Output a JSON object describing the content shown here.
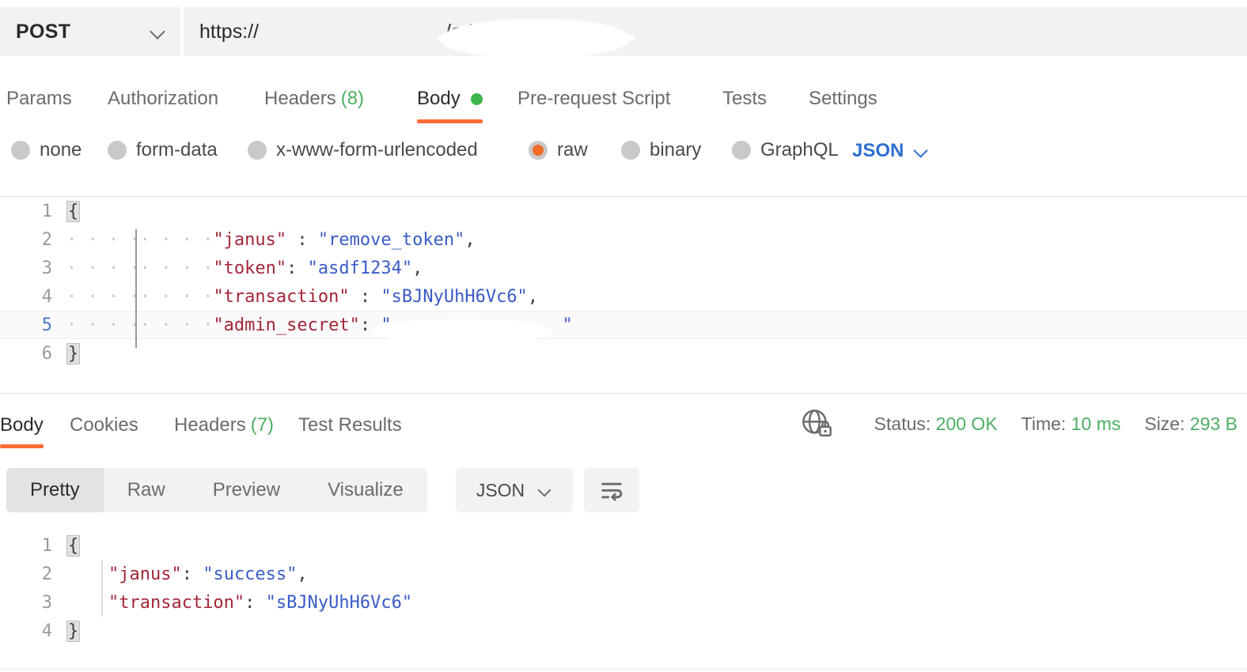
{
  "request": {
    "method": "POST",
    "method_icon": "chevron-down-icon",
    "url_prefix": "https://",
    "url_suffix": "/admin",
    "url_full": "https:// /admin",
    "url_redacted": true,
    "tabs": [
      {
        "label": "Params",
        "active": false,
        "count": "",
        "dot": false
      },
      {
        "label": "Authorization",
        "active": false,
        "count": "",
        "dot": false
      },
      {
        "label": "Headers",
        "active": false,
        "count": "(8)",
        "dot": false
      },
      {
        "label": "Body",
        "active": true,
        "count": "",
        "dot": true
      },
      {
        "label": "Pre-request Script",
        "active": false,
        "count": "",
        "dot": false
      },
      {
        "label": "Tests",
        "active": false,
        "count": "",
        "dot": false
      },
      {
        "label": "Settings",
        "active": false,
        "count": "",
        "dot": false
      }
    ],
    "body_types": [
      {
        "label": "none",
        "selected": false
      },
      {
        "label": "form-data",
        "selected": false
      },
      {
        "label": "x-www-form-urlencoded",
        "selected": false
      },
      {
        "label": "raw",
        "selected": true
      },
      {
        "label": "binary",
        "selected": false
      },
      {
        "label": "GraphQL",
        "selected": false
      }
    ],
    "format": "JSON",
    "format_icon": "chevron-down-icon",
    "body_lines": [
      {
        "n": "1",
        "active": false
      },
      {
        "n": "2",
        "active": false
      },
      {
        "n": "3",
        "active": false
      },
      {
        "n": "4",
        "active": false
      },
      {
        "n": "5",
        "active": true
      },
      {
        "n": "6",
        "active": false
      }
    ],
    "body": {
      "l1_brace": "{",
      "l2_key": "\"janus\"",
      "l2_colon": " : ",
      "l2_val": "\"remove_token\"",
      "l2_comma": ",",
      "l3_key": "\"token\"",
      "l3_colon": ": ",
      "l3_val": "\"asdf1234\"",
      "l3_comma": ",",
      "l4_key": "\"transaction\"",
      "l4_colon": " : ",
      "l4_val": "\"sBJNyUhH6Vc6\"",
      "l4_comma": ",",
      "l5_key": "\"admin_secret\"",
      "l5_colon": ": ",
      "l5_val_open": "\"",
      "l5_val_close": "\"",
      "l6_brace": "}",
      "indent": "· · · ·· · · ·"
    }
  },
  "response": {
    "tabs": [
      {
        "label": "Body",
        "active": true,
        "count": ""
      },
      {
        "label": "Cookies",
        "active": false,
        "count": ""
      },
      {
        "label": "Headers",
        "active": false,
        "count": "(7)"
      },
      {
        "label": "Test Results",
        "active": false,
        "count": ""
      }
    ],
    "security_icon": "globe-lock-icon",
    "meta": {
      "status_label": "Status:",
      "status_value": "200 OK",
      "time_label": "Time:",
      "time_value": "10 ms",
      "size_label": "Size:",
      "size_value": "293 B"
    },
    "view_modes": [
      {
        "label": "Pretty",
        "active": true
      },
      {
        "label": "Raw",
        "active": false
      },
      {
        "label": "Preview",
        "active": false
      },
      {
        "label": "Visualize",
        "active": false
      }
    ],
    "format": "JSON",
    "format_icon": "chevron-down-icon",
    "wrap_icon": "word-wrap-icon",
    "body_lines": [
      {
        "n": "1"
      },
      {
        "n": "2"
      },
      {
        "n": "3"
      },
      {
        "n": "4"
      }
    ],
    "body": {
      "l1_brace": "{",
      "l2_key": "\"janus\"",
      "l2_colon": ": ",
      "l2_val": "\"success\"",
      "l2_comma": ",",
      "l3_key": "\"transaction\"",
      "l3_colon": ": ",
      "l3_val": "\"sBJNyUhH6Vc6\"",
      "l3_comma": "",
      "l4_brace": "}",
      "indent": "    "
    }
  },
  "colors": {
    "accent_orange": "#ff6c37",
    "radio_selected": "#f26c2a",
    "status_green": "#4caf63",
    "dot_green": "#3cb54b",
    "json_key": "#a32638",
    "json_value": "#3a5bc7",
    "link_blue": "#2f6fd0"
  }
}
